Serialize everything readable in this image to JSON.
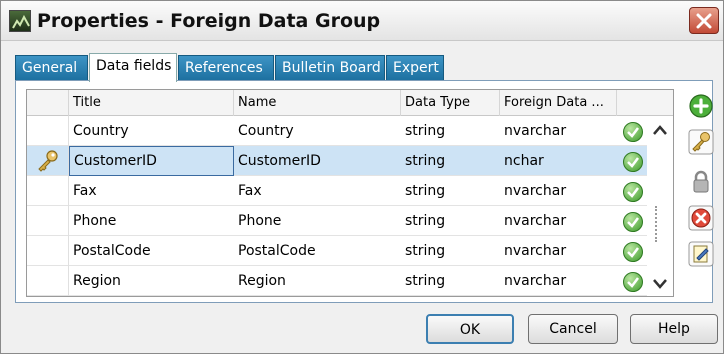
{
  "window": {
    "title": "Properties - Foreign Data Group"
  },
  "tabs": [
    {
      "label": "General"
    },
    {
      "label": "Data fields",
      "active": true
    },
    {
      "label": "References"
    },
    {
      "label": "Bulletin Board"
    },
    {
      "label": "Expert"
    }
  ],
  "grid": {
    "columns": [
      "Title",
      "Name",
      "Data Type",
      "Foreign Data ..."
    ],
    "rows": [
      {
        "title": "Country",
        "name": "Country",
        "data_type": "string",
        "foreign": "nvarchar",
        "key": false,
        "selected": false
      },
      {
        "title": "CustomerID",
        "name": "CustomerID",
        "data_type": "string",
        "foreign": "nchar",
        "key": true,
        "selected": true
      },
      {
        "title": "Fax",
        "name": "Fax",
        "data_type": "string",
        "foreign": "nvarchar",
        "key": false,
        "selected": false
      },
      {
        "title": "Phone",
        "name": "Phone",
        "data_type": "string",
        "foreign": "nvarchar",
        "key": false,
        "selected": false
      },
      {
        "title": "PostalCode",
        "name": "PostalCode",
        "data_type": "string",
        "foreign": "nvarchar",
        "key": false,
        "selected": false
      },
      {
        "title": "Region",
        "name": "Region",
        "data_type": "string",
        "foreign": "nvarchar",
        "key": false,
        "selected": false
      }
    ]
  },
  "side_toolbar": {
    "icons": [
      "add-icon",
      "key-icon",
      "lock-icon",
      "delete-icon",
      "edit-icon"
    ]
  },
  "footer": {
    "ok_label": "OK",
    "cancel_label": "Cancel",
    "help_label": "Help"
  },
  "colors": {
    "tab_inactive": "#2a82b5",
    "selection": "#cde3f5",
    "check_green": "#3d9a2c",
    "close_red": "#c24a36"
  }
}
